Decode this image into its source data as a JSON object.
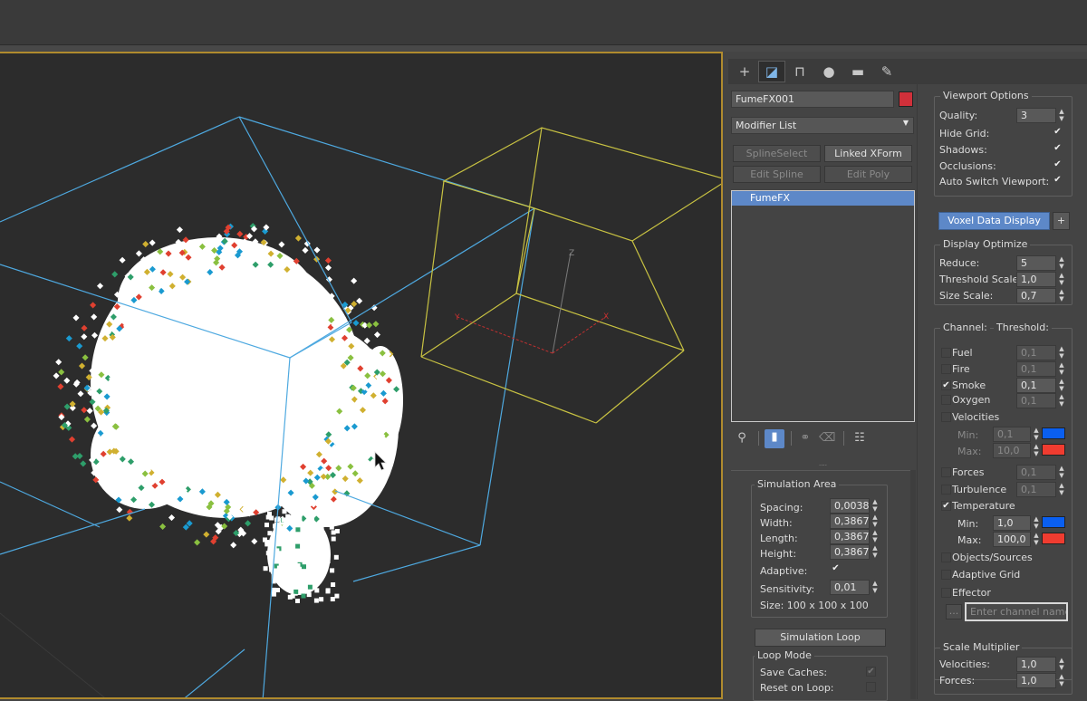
{
  "colors": {
    "accent": "#5d88c8",
    "viewport_border": "#b08b2e",
    "bbox_blue": "#4ea9e0",
    "gizmo_yellow": "#c8c242",
    "object_color": "#d0303a",
    "swatch_blue": "#0a5ff0",
    "swatch_red": "#f03c30"
  },
  "tabs": [
    {
      "icon": "plus-create-icon",
      "glyph": "+"
    },
    {
      "icon": "modify-icon",
      "glyph": "◪"
    },
    {
      "icon": "hierarchy-icon",
      "glyph": "⊓"
    },
    {
      "icon": "motion-icon",
      "glyph": "●"
    },
    {
      "icon": "display-icon",
      "glyph": "▬"
    },
    {
      "icon": "utilities-wrench-icon",
      "glyph": "✎"
    }
  ],
  "object": {
    "name": "FumeFX001",
    "modifier_list": "Modifier List"
  },
  "modifier_buttons": {
    "spline_select": "SplineSelect",
    "linked_xform": "Linked XForm",
    "edit_spline": "Edit Spline",
    "edit_poly": "Edit Poly"
  },
  "stack": {
    "items": [
      "FumeFX"
    ]
  },
  "stack_tools": [
    "pin-stack-icon",
    "show-end-result-icon",
    "make-unique-icon",
    "remove-modifier-icon",
    "configure-sets-icon"
  ],
  "simulation_area": {
    "title": "Simulation Area",
    "spacing_label": "Spacing:",
    "spacing": "0,00386",
    "width_label": "Width:",
    "width": "0,38673",
    "length_label": "Length:",
    "length": "0,38673",
    "height_label": "Height:",
    "height": "0,38673",
    "adaptive_label": "Adaptive:",
    "sensitivity_label": "Sensitivity:",
    "sensitivity": "0,01",
    "size": "Size: 100 x 100 x 100"
  },
  "simulation_loop": {
    "button": "Simulation Loop",
    "loop_mode": "Loop Mode",
    "save_caches": "Save Caches:",
    "reset_on_loop": "Reset on Loop:"
  },
  "viewport_options": {
    "title": "Viewport Options",
    "quality_label": "Quality:",
    "quality": "3",
    "hide_grid": "Hide Grid:",
    "shadows": "Shadows:",
    "occlusions": "Occlusions:",
    "auto_switch": "Auto Switch Viewport:"
  },
  "voxel_button": "Voxel Data Display",
  "plus_label": "+",
  "display_optimize": {
    "title": "Display Optimize",
    "reduce_label": "Reduce:",
    "reduce": "5",
    "threshold_scale_label": "Threshold Scale:",
    "threshold_scale": "1,0",
    "size_scale_label": "Size Scale:",
    "size_scale": "0,7"
  },
  "channels": {
    "channel_header": "Channel:",
    "threshold_header": "Threshold:",
    "fuel": "Fuel",
    "fuel_val": "0,1",
    "fire": "Fire",
    "fire_val": "0,1",
    "smoke": "Smoke",
    "smoke_val": "0,1",
    "oxygen": "Oxygen",
    "oxygen_val": "0,1",
    "velocities": "Velocities",
    "vel_min_label": "Min:",
    "vel_min": "0,1",
    "vel_max_label": "Max:",
    "vel_max": "10,0",
    "forces": "Forces",
    "forces_val": "0,1",
    "turbulence": "Turbulence",
    "turbulence_val": "0,1",
    "temperature": "Temperature",
    "temp_min_label": "Min:",
    "temp_min": "1,0",
    "temp_max_label": "Max:",
    "temp_max": "100,0",
    "objects_sources": "Objects/Sources",
    "adaptive_grid": "Adaptive Grid",
    "effector": "Effector",
    "ellipsis": "...",
    "channel_name_placeholder": "Enter channel name"
  },
  "scale_multiplier": {
    "title": "Scale Multiplier",
    "velocities_label": "Velocities:",
    "velocities": "1,0",
    "forces_label": "Forces:",
    "forces": "1,0"
  },
  "axis_labels": {
    "x": "X",
    "y": "Y",
    "z": "Z"
  }
}
